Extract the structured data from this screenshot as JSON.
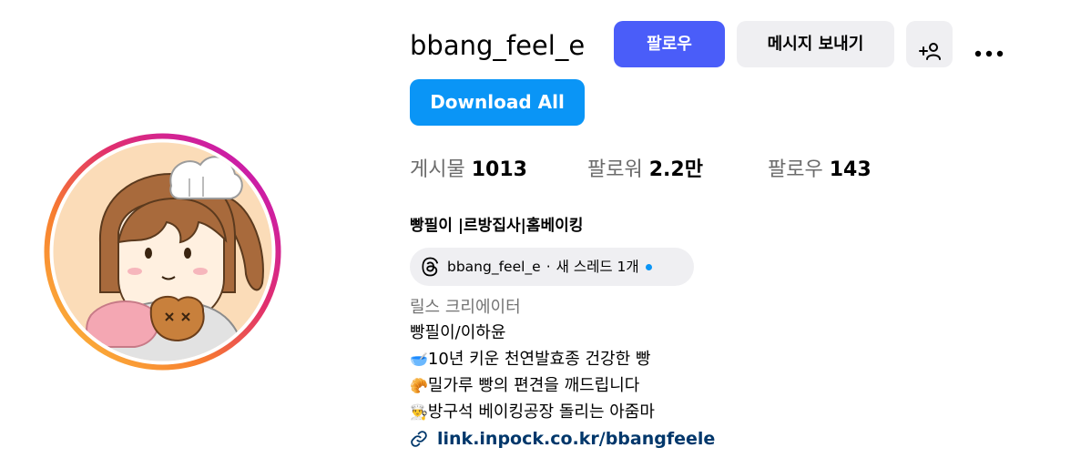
{
  "profile": {
    "username": "bbang_feel_e",
    "fullname": "빵필이 |르방집사|홈베이킹"
  },
  "actions": {
    "follow_label": "팔로우",
    "message_label": "메시지 보내기",
    "download_label": "Download All"
  },
  "stats": {
    "posts_label": "게시물",
    "posts_value": "1013",
    "followers_label": "팔로워",
    "followers_value": "2.2만",
    "following_label": "팔로우",
    "following_value": "143"
  },
  "threads": {
    "handle": "bbang_feel_e",
    "separator": "·",
    "status": "새 스레드 1개"
  },
  "bio": {
    "category": "릴스 크리에이터",
    "line1": "빵필이/이하윤",
    "line2": "10년 키운 천연발효종 건강한 빵",
    "line3": "밀가루 빵의 편견을 깨드립니다",
    "line4": "방구석 베이킹공장 돌리는 아줌마",
    "link": "link.inpock.co.kr/bbangfeele"
  },
  "icons": {
    "add_user": "add-user-icon",
    "more": "more-icon",
    "threads": "threads-icon",
    "link": "link-icon",
    "bowl": "🥣",
    "croissant": "🥐",
    "chef": "👨‍🍳"
  },
  "colors": {
    "follow_button": "#4a5df9",
    "download_button": "#0a95f6",
    "secondary_button": "#efeff2",
    "link_text": "#00376b",
    "muted_text": "#737373"
  }
}
